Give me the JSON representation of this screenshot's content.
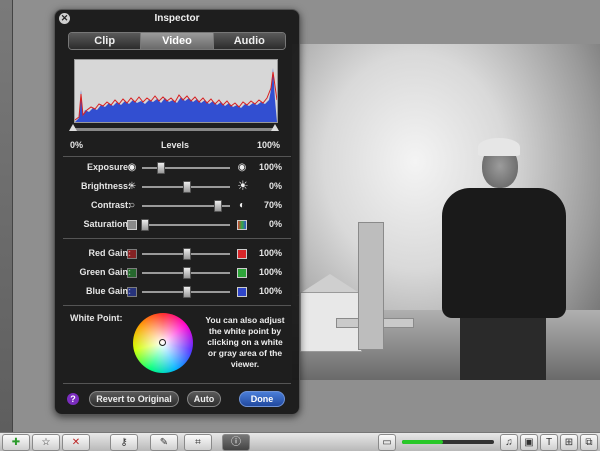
{
  "inspector": {
    "title": "Inspector",
    "close_icon": "close-icon",
    "tabs": [
      {
        "label": "Clip",
        "active": false
      },
      {
        "label": "Video",
        "active": true
      },
      {
        "label": "Audio",
        "active": false
      }
    ],
    "levels": {
      "min_label": "0%",
      "label": "Levels",
      "max_label": "100%"
    },
    "adjustments": [
      {
        "label": "Exposure:",
        "value": "100%",
        "level": 0.2
      },
      {
        "label": "Brightness:",
        "value": "0%",
        "level": 0.5
      },
      {
        "label": "Contrast:",
        "value": "70%",
        "level": 0.85
      },
      {
        "label": "Saturation:",
        "value": "0%",
        "level": 0.02
      }
    ],
    "gains": [
      {
        "label": "Red Gain:",
        "value": "100%",
        "level": 0.5,
        "color": "#d8262a"
      },
      {
        "label": "Green Gain:",
        "value": "100%",
        "level": 0.5,
        "color": "#2ea43a"
      },
      {
        "label": "Blue Gain:",
        "value": "100%",
        "level": 0.5,
        "color": "#2f45c8"
      }
    ],
    "white_point": {
      "label": "White Point:",
      "hint": "You can also adjust the white point by clicking on a white or gray area of the viewer."
    },
    "buttons": {
      "help": "?",
      "revert": "Revert to Original",
      "auto": "Auto",
      "done": "Done"
    }
  },
  "toolbar": {
    "icons": [
      "add-icon",
      "star-icon",
      "reject-icon",
      "keyword-icon",
      "eyedropper-icon",
      "crop-icon",
      "info-icon"
    ]
  },
  "colors": {
    "accent": "#2b5fc4",
    "histogram_red": "#d82020",
    "histogram_blue": "#2040d0"
  }
}
